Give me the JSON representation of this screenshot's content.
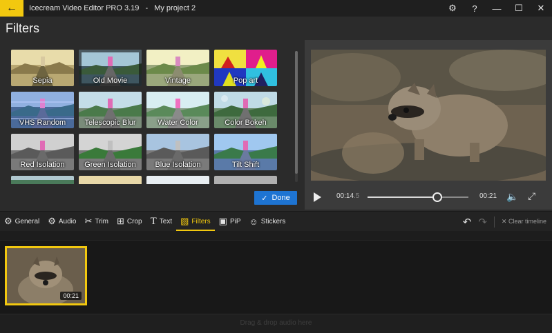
{
  "titlebar": {
    "app_name": "Icecream Video Editor PRO 3.19",
    "separator": "-",
    "project_name": "My project 2",
    "back_icon": "arrow-left-icon",
    "settings_icon": "gear-icon",
    "help_label": "?",
    "minimize_label": "—",
    "maximize_label": "☐",
    "close_label": "✕",
    "accent_color": "#f2c80f"
  },
  "page": {
    "title": "Filters"
  },
  "filters": [
    {
      "label": "Sepia"
    },
    {
      "label": "Old Movie"
    },
    {
      "label": "Vintage"
    },
    {
      "label": "Pop art"
    },
    {
      "label": "VHS Random"
    },
    {
      "label": "Telescopic Blur"
    },
    {
      "label": "Water Color"
    },
    {
      "label": "Color Bokeh"
    },
    {
      "label": "Red Isolation"
    },
    {
      "label": "Green Isolation"
    },
    {
      "label": "Blue Isolation"
    },
    {
      "label": "Tilt Shift"
    },
    {
      "label": ""
    },
    {
      "label": ""
    },
    {
      "label": ""
    },
    {
      "label": ""
    }
  ],
  "done_button": {
    "label": "Done",
    "color": "#1e74d2"
  },
  "player": {
    "current_time_main": "00:14",
    "current_time_frac": ".5",
    "duration": "00:21",
    "progress": 0.69
  },
  "toolbar": {
    "tools": [
      {
        "label": "General",
        "icon": "gear-icon"
      },
      {
        "label": "Audio",
        "icon": "gear-icon"
      },
      {
        "label": "Trim",
        "icon": "scissors-icon"
      },
      {
        "label": "Crop",
        "icon": "crop-icon"
      },
      {
        "label": "Text",
        "icon": "text-icon"
      },
      {
        "label": "Filters",
        "icon": "filter-icon"
      },
      {
        "label": "PiP",
        "icon": "pip-icon"
      },
      {
        "label": "Stickers",
        "icon": "smiley-icon"
      }
    ],
    "clear_timeline_label": "Clear timeline"
  },
  "timeline": {
    "clip_duration": "00:21",
    "audio_hint": "Drag & drop audio here"
  }
}
